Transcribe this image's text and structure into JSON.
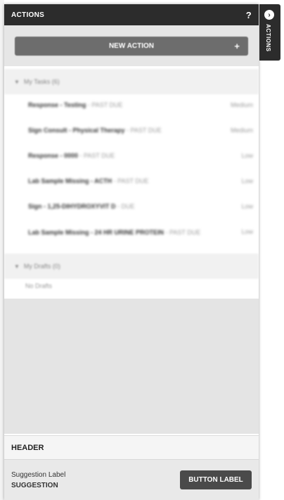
{
  "panel": {
    "title": "ACTIONS",
    "help": "?"
  },
  "new_action": {
    "label": "NEW ACTION",
    "plus": "+"
  },
  "tasks_section": {
    "label": "My Tasks (6)"
  },
  "tasks": [
    {
      "name": "Response - Testing",
      "status": " - PAST DUE",
      "priority": "Medium"
    },
    {
      "name": "Sign Consult - Physical Therapy",
      "status": " - PAST DUE",
      "priority": "Medium"
    },
    {
      "name": "Response - 0000",
      "status": " - PAST DUE",
      "priority": "Low"
    },
    {
      "name": "Lab Sample Missing - ACTH",
      "status": " - PAST DUE",
      "priority": "Low"
    },
    {
      "name": "Sign - 1,25-DIHYDROXYVIT D",
      "status": " - DUE",
      "priority": "Low"
    },
    {
      "name": "Lab Sample Missing - 24 HR URINE PROTEIN",
      "status": " - PAST DUE",
      "priority": "Low"
    }
  ],
  "drafts_section": {
    "label": "My Drafts (0)",
    "empty": "No Drafts"
  },
  "footer": {
    "header": "HEADER",
    "suggestion_label": "Suggestion Label",
    "suggestion_value": "SUGGESTION",
    "button_label": "BUTTON LABEL"
  },
  "side_tab": {
    "label": "ACTIONS"
  }
}
